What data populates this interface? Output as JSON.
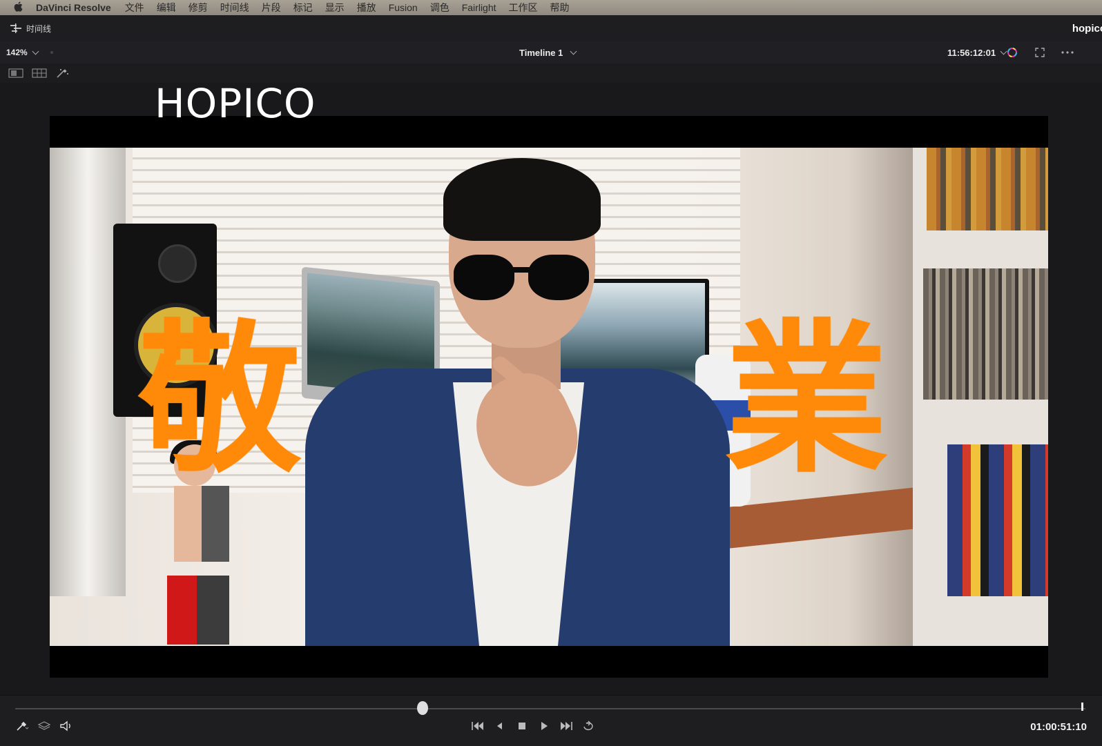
{
  "menubar": {
    "app_name": "DaVinci Resolve",
    "items": [
      "文件",
      "编辑",
      "修剪",
      "时间线",
      "片段",
      "标记",
      "显示",
      "播放",
      "Fusion",
      "调色",
      "Fairlight",
      "工作区",
      "帮助"
    ]
  },
  "titlebar": {
    "section_label": "时间线",
    "project_name": "hopico"
  },
  "viewer": {
    "zoom": "142%",
    "timeline_name": "Timeline 1",
    "timecode": "11:56:12:01"
  },
  "overlay": {
    "title_text": "HOPICO",
    "left_char": "敬",
    "right_char": "業",
    "accent_color": "#ff8a0a"
  },
  "transport": {
    "timecode": "01:00:51:10",
    "controls": [
      "skip-to-start",
      "step-back",
      "stop",
      "play",
      "skip-to-end",
      "loop"
    ]
  }
}
